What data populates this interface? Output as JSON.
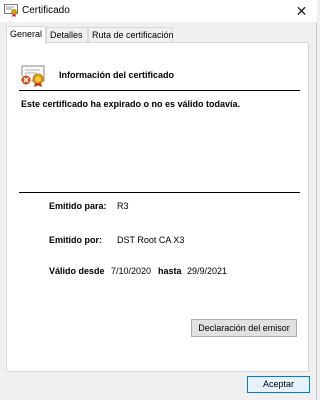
{
  "window": {
    "title": "Certificado",
    "close_glyph": "✕"
  },
  "tabs": [
    {
      "label": "General",
      "active": true
    },
    {
      "label": "Detalles",
      "active": false
    },
    {
      "label": "Ruta de certificación",
      "active": false
    }
  ],
  "info": {
    "icon": "certificate-error-icon",
    "title": "Información del certificado",
    "status_message": "Este certificado ha expirado o no es válido todavía."
  },
  "fields": {
    "issued_to_label": "Emitido para:",
    "issued_to_value": "R3",
    "issued_by_label": "Emitido por:",
    "issued_by_value": "DST Root CA X3",
    "valid_from_label": "Válido desde",
    "valid_from_value": "7/10/2020",
    "valid_to_label": "hasta",
    "valid_to_value": "29/9/2021"
  },
  "buttons": {
    "issuer_statement": "Declaración del emisor",
    "accept": "Aceptar"
  },
  "colors": {
    "accent": "#0078d7",
    "error_red": "#d83b01",
    "seal_gold": "#e0a100"
  }
}
